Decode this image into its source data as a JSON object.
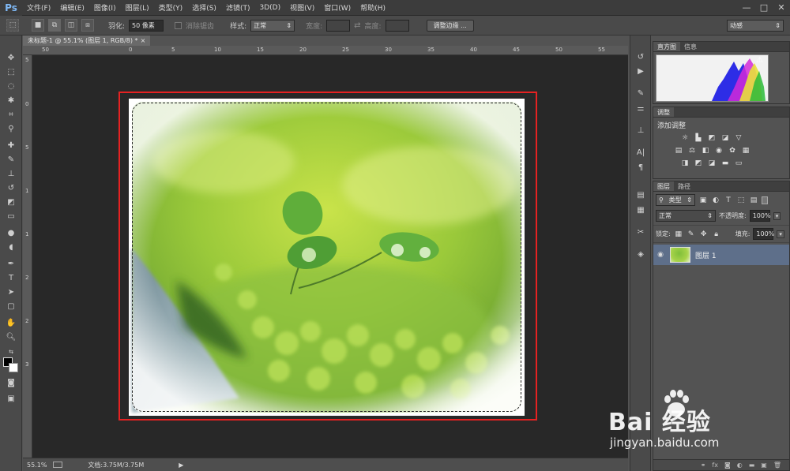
{
  "app": {
    "logo": "Ps"
  },
  "menu": [
    "文件(F)",
    "编辑(E)",
    "图像(I)",
    "图层(L)",
    "类型(Y)",
    "选择(S)",
    "滤镜(T)",
    "3D(D)",
    "视图(V)",
    "窗口(W)",
    "帮助(H)"
  ],
  "window_controls": {
    "minimize": "—",
    "maximize": "□",
    "close": "✕"
  },
  "options": {
    "feather_label": "羽化:",
    "feather_value": "50 像素",
    "antialias_label": "消除锯齿",
    "style_label": "样式:",
    "style_value": "正常",
    "width_label": "宽度:",
    "height_label": "高度:",
    "refine_edge": "调整边缘 ...",
    "workspace": "动感"
  },
  "document": {
    "tab_title": "未标题-1 @ 55.1% (图层 1, RGB/8) * ",
    "tab_close": "×",
    "ruler_top": [
      "50",
      "0",
      "5",
      "10",
      "15",
      "20",
      "25",
      "30",
      "35",
      "40",
      "45",
      "50",
      "55"
    ],
    "ruler_left": [
      "5",
      "0",
      "5",
      "1",
      "1",
      "2",
      "2",
      "3"
    ],
    "zoom": "55.1%",
    "doc_size": "文档:3.75M/3.75M"
  },
  "panels": {
    "histogram_tabs": [
      "直方图",
      "信息"
    ],
    "adjust_tab": "调整",
    "adjust_title": "添加调整",
    "layers_tabs": [
      "图层",
      "路径"
    ],
    "filter_kind": "类型",
    "blend_mode": "正常",
    "opacity_label": "不透明度:",
    "opacity_value": "100%",
    "lock_label": "锁定:",
    "fill_label": "填充:",
    "fill_value": "100%",
    "layer_name": "图层 1",
    "footer_icons": [
      "link-icon",
      "fx-icon",
      "mask-icon",
      "adjustment-icon",
      "group-icon",
      "new-layer-icon",
      "trash-icon"
    ]
  },
  "watermark": {
    "brand": "Bai 经验",
    "url": "jingyan.baidu.com"
  },
  "colors": {
    "highlight": "#e52222",
    "layer_selected": "#5e6f8a"
  }
}
